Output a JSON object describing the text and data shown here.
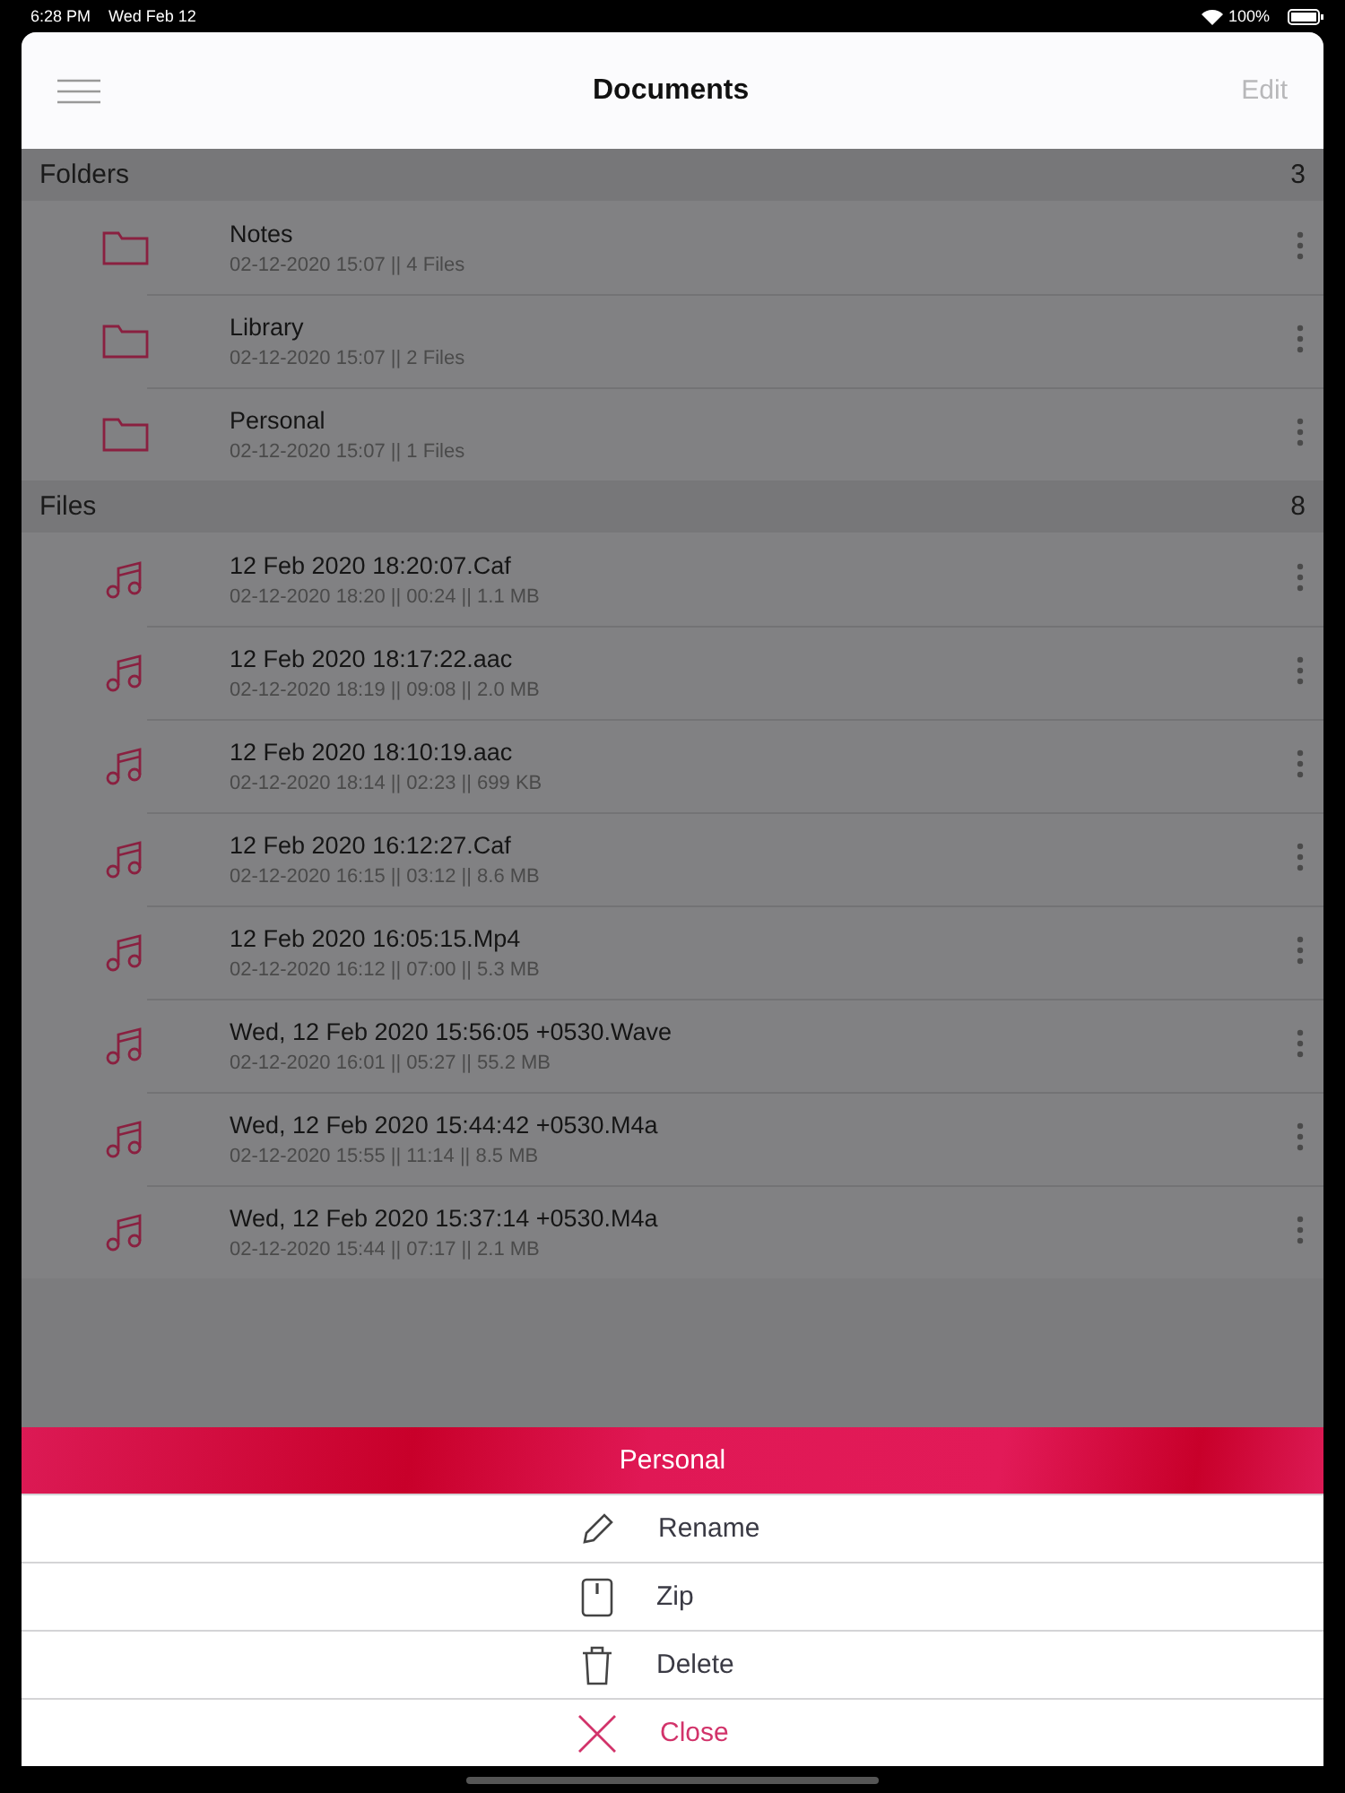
{
  "status_bar": {
    "time": "6:28 PM",
    "date": "Wed Feb 12",
    "battery": "100%"
  },
  "nav": {
    "title": "Documents",
    "edit": "Edit"
  },
  "sections": [
    {
      "title": "Folders",
      "count": "3",
      "kind": "folder",
      "items": [
        {
          "name": "Notes",
          "detail": "02-12-2020 15:07 || 4 Files"
        },
        {
          "name": "Library",
          "detail": "02-12-2020 15:07 || 2 Files"
        },
        {
          "name": "Personal",
          "detail": "02-12-2020 15:07 || 1 Files"
        }
      ]
    },
    {
      "title": "Files",
      "count": "8",
      "kind": "audio",
      "items": [
        {
          "name": "12 Feb 2020 18:20:07.Caf",
          "detail": "02-12-2020 18:20 || 00:24 || 1.1 MB"
        },
        {
          "name": "12 Feb 2020 18:17:22.aac",
          "detail": "02-12-2020 18:19 || 09:08 || 2.0 MB"
        },
        {
          "name": "12 Feb 2020 18:10:19.aac",
          "detail": "02-12-2020 18:14 || 02:23 || 699 KB"
        },
        {
          "name": "12 Feb 2020 16:12:27.Caf",
          "detail": "02-12-2020 16:15 || 03:12 || 8.6 MB"
        },
        {
          "name": "12 Feb 2020 16:05:15.Mp4",
          "detail": "02-12-2020 16:12 || 07:00 || 5.3 MB"
        },
        {
          "name": "Wed, 12 Feb 2020 15:56:05 +0530.Wave",
          "detail": "02-12-2020 16:01 || 05:27 || 55.2 MB"
        },
        {
          "name": "Wed, 12 Feb 2020 15:44:42 +0530.M4a",
          "detail": "02-12-2020 15:55 || 11:14 || 8.5 MB"
        },
        {
          "name": "Wed, 12 Feb 2020 15:37:14 +0530.M4a",
          "detail": "02-12-2020 15:44 || 07:17 || 2.1 MB"
        }
      ]
    }
  ],
  "action_sheet": {
    "title": "Personal",
    "actions": [
      {
        "label": "Rename",
        "kind": "rename"
      },
      {
        "label": "Zip",
        "kind": "zip"
      },
      {
        "label": "Delete",
        "kind": "delete"
      },
      {
        "label": "Close",
        "kind": "close"
      }
    ]
  }
}
